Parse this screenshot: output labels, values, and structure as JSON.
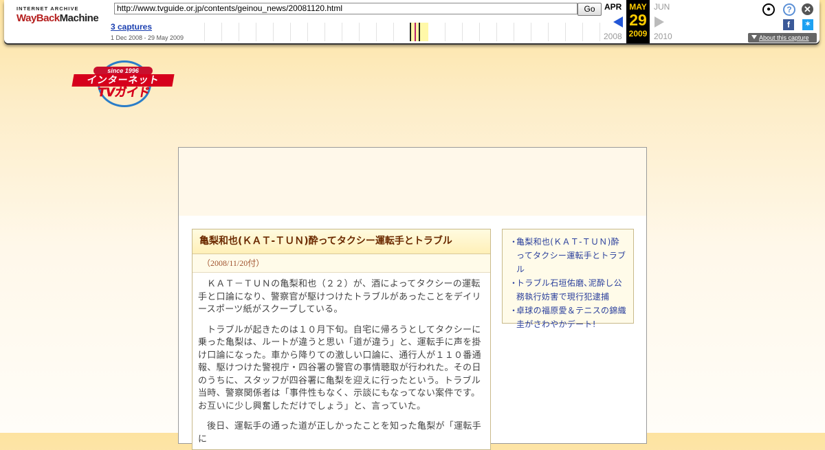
{
  "wayback": {
    "logo_top": "INTERNET ARCHIVE",
    "logo_wayback": "WayBack",
    "logo_machine": "Machine",
    "url": "http://www.tvguide.or.jp/contents/geinou_news/20081120.html",
    "go_label": "Go",
    "captures_label": "3 captures",
    "captures_range": "1 Dec 2008 - 29 May 2009",
    "prev_month": "APR",
    "current_month": "MAY",
    "current_day": "29",
    "current_year": "2009",
    "next_month": "JUN",
    "prev_year": "2008",
    "next_year": "2010",
    "about_label": "About this capture",
    "icons": [
      "user-icon",
      "help-icon",
      "close-icon",
      "facebook-icon",
      "twitter-icon"
    ]
  },
  "site": {
    "logo_since": "since 1996",
    "logo_line1": "インターネット",
    "logo_line2": "TVガイド"
  },
  "article": {
    "title": "亀梨和也(ＫＡＴ-ＴＵＮ)酔ってタクシー運転手とトラブル",
    "date": "（2008/11/20付）",
    "paragraphs": [
      "ＫＡＴ－ＴＵＮの亀梨和也（２２）が、酒によってタクシーの運転手と口論になり、警察官が駆けつけたトラブルがあったことをデイリースポーツ紙がスクープしている。",
      "トラブルが起きたのは１０月下旬。自宅に帰ろうとしてタクシーに乗った亀梨は、ルートが違うと思い「道が違う」と、運転手に声を掛け口論になった。車から降りての激しい口論に、通行人が１１０番通報、駆けつけた警視庁・四谷署の警官の事情聴取が行われた。その日のうちに、スタッフが四谷署に亀梨を迎えに行ったという。トラブル当時、警察関係者は「事件性もなく、示談にもなってない案件です。お互いに少し興奮しただけでしょう」と、言っていた。",
      "後日、運転手の通った道が正しかったことを知った亀梨が「運転手に"
    ]
  },
  "related": {
    "bullet": "・",
    "items": [
      "亀梨和也(ＫＡＴ-ＴＵＮ)酔ってタクシー運転手とトラブル",
      "トラブル石垣佑磨､泥酔し公務執行妨害で現行犯逮捕",
      "卓球の福原愛＆テニスの錦織圭がさわやかデート!"
    ]
  },
  "colors": {
    "page_bg_top": "#fde3a0",
    "title_text": "#6b2a00",
    "date_text": "#a0522d",
    "link_text": "#2a3f9c",
    "wayback_highlight": "#ffcd00"
  }
}
